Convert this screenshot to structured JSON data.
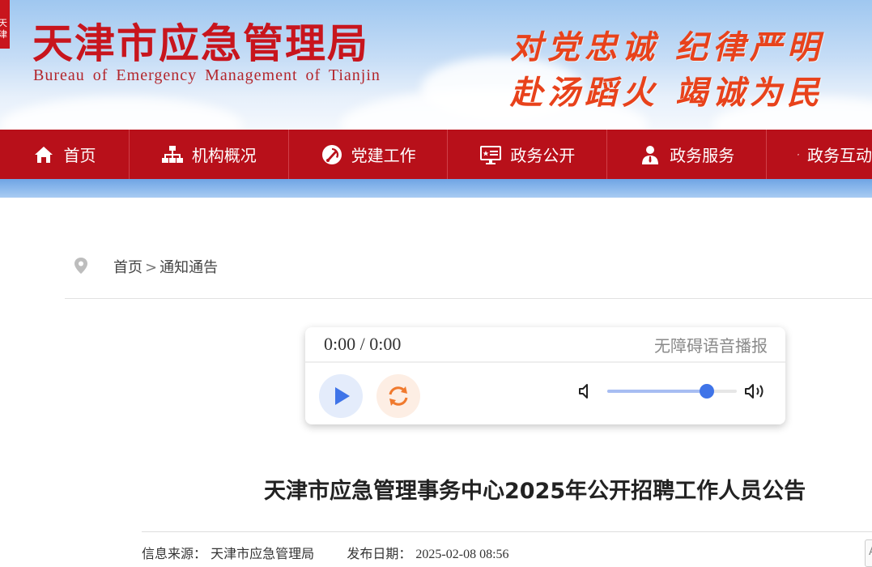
{
  "header": {
    "title": "天津市应急管理局",
    "subtitle": "Bureau of Emergency Management of Tianjin",
    "slogan_line1": "对党忠诚  纪律严明",
    "slogan_line2": "赴汤蹈火  竭诚为民",
    "stripe_text": "天津"
  },
  "nav": {
    "items": [
      {
        "label": "首页",
        "icon": "home-icon"
      },
      {
        "label": "机构概况",
        "icon": "org-chart-icon"
      },
      {
        "label": "党建工作",
        "icon": "party-emblem-icon"
      },
      {
        "label": "政务公开",
        "icon": "screen-icon"
      },
      {
        "label": "政务服务",
        "icon": "person-icon"
      },
      {
        "label": "政务互动",
        "icon": "chat-icon"
      }
    ]
  },
  "breadcrumb": {
    "home": "首页",
    "separator": ">",
    "current": "通知通告"
  },
  "player": {
    "time": "0:00 / 0:00",
    "label": "无障碍语音播报",
    "volume": 0.8
  },
  "article": {
    "title": "天津市应急管理事务中心2025年公开招聘工作人员公告",
    "source_label": "信息来源：",
    "source": "天津市应急管理局",
    "date_label": "发布日期：",
    "date": "2025-02-08 08:56",
    "font_tool": "A"
  },
  "colors": {
    "brand_red": "#b8101a",
    "title_red": "#c8151d",
    "slogan_orange": "#e8421b",
    "accent_blue": "#3f74e8"
  }
}
